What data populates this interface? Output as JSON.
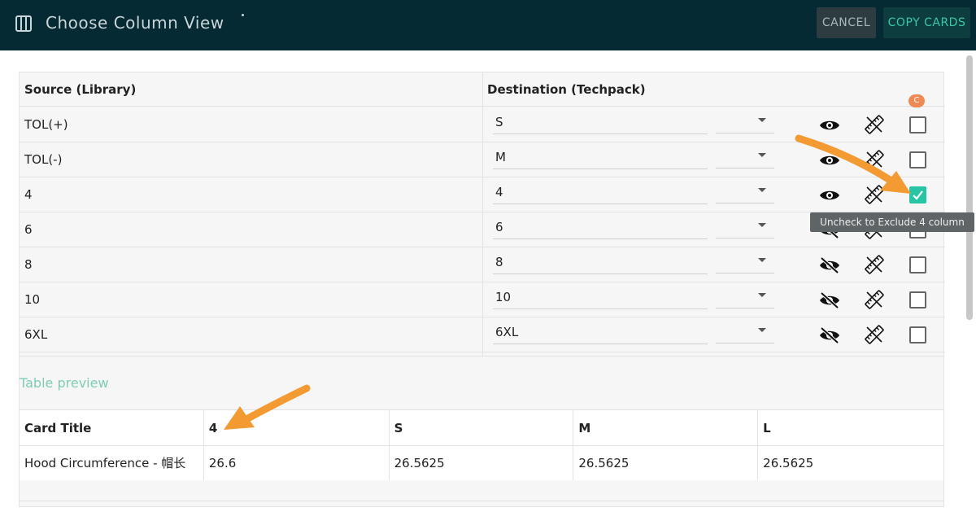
{
  "dialog": {
    "title": "Choose Column View",
    "cancel_label": "CANCEL",
    "copy_label": "COPY CARDS"
  },
  "mapping": {
    "header_source": "Source (Library)",
    "header_destination": "Destination (Techpack)",
    "badge": "C",
    "rows": [
      {
        "source": "TOL(+)",
        "destination": "S",
        "visible": true,
        "checked": false
      },
      {
        "source": "TOL(-)",
        "destination": "M",
        "visible": true,
        "checked": false
      },
      {
        "source": "4",
        "destination": "4",
        "visible": true,
        "checked": true
      },
      {
        "source": "6",
        "destination": "6",
        "visible": false,
        "checked": false
      },
      {
        "source": "8",
        "destination": "8",
        "visible": false,
        "checked": false
      },
      {
        "source": "10",
        "destination": "10",
        "visible": false,
        "checked": false
      },
      {
        "source": "6XL",
        "destination": "6XL",
        "visible": false,
        "checked": false
      }
    ],
    "tooltip": "Uncheck to Exclude 4 column"
  },
  "preview": {
    "label": "Table preview",
    "columns": [
      "Card Title",
      "4",
      "S",
      "M",
      "L"
    ],
    "rows": [
      [
        "Hood Circumference - 帽长",
        "26.6",
        "26.5625",
        "26.5625",
        "26.5625"
      ]
    ]
  },
  "colors": {
    "titlebar": "#062a33",
    "accent": "#27c4a6",
    "annotation_arrow": "#f39a33"
  }
}
